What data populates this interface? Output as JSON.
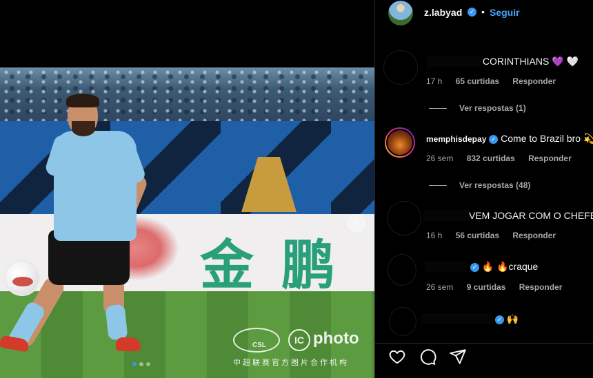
{
  "post": {
    "carousel_total": 3,
    "carousel_active": 1,
    "ad_text": "金鹏",
    "watermark": {
      "csl": "CSL",
      "ic": "IC",
      "photo": "photo",
      "caption": "中超联赛官方图片合作机构"
    }
  },
  "header": {
    "username": "z.labyad",
    "separator": "•",
    "follow_label": "Seguir"
  },
  "comments": [
    {
      "text": " CORINTHIANS 💜 🤍",
      "time": "17 h",
      "likes": "65 curtidas",
      "reply": "Responder",
      "view_replies": "Ver respostas (1)"
    },
    {
      "username": "memphisdepay",
      "text": "Come to Brazil bro 💫",
      "time": "26 sem",
      "likes": "832 curtidas",
      "reply": "Responder",
      "view_replies": "Ver respostas (48)"
    },
    {
      "text": "VEM JOGAR COM O CHEFE",
      "time": "16 h",
      "likes": "56 curtidas",
      "reply": "Responder"
    },
    {
      "text": "🔥 🔥craque",
      "time": "26 sem",
      "likes": "9 curtidas",
      "reply": "Responder"
    },
    {
      "text": "🙌"
    }
  ],
  "icons": {
    "like": "heart-icon",
    "comment": "comment-icon",
    "share": "paper-plane-icon",
    "next": "chevron-right-icon"
  },
  "colors": {
    "accent": "#3897f0",
    "follow": "#4aa3f5",
    "meta": "#a8a8a8"
  }
}
